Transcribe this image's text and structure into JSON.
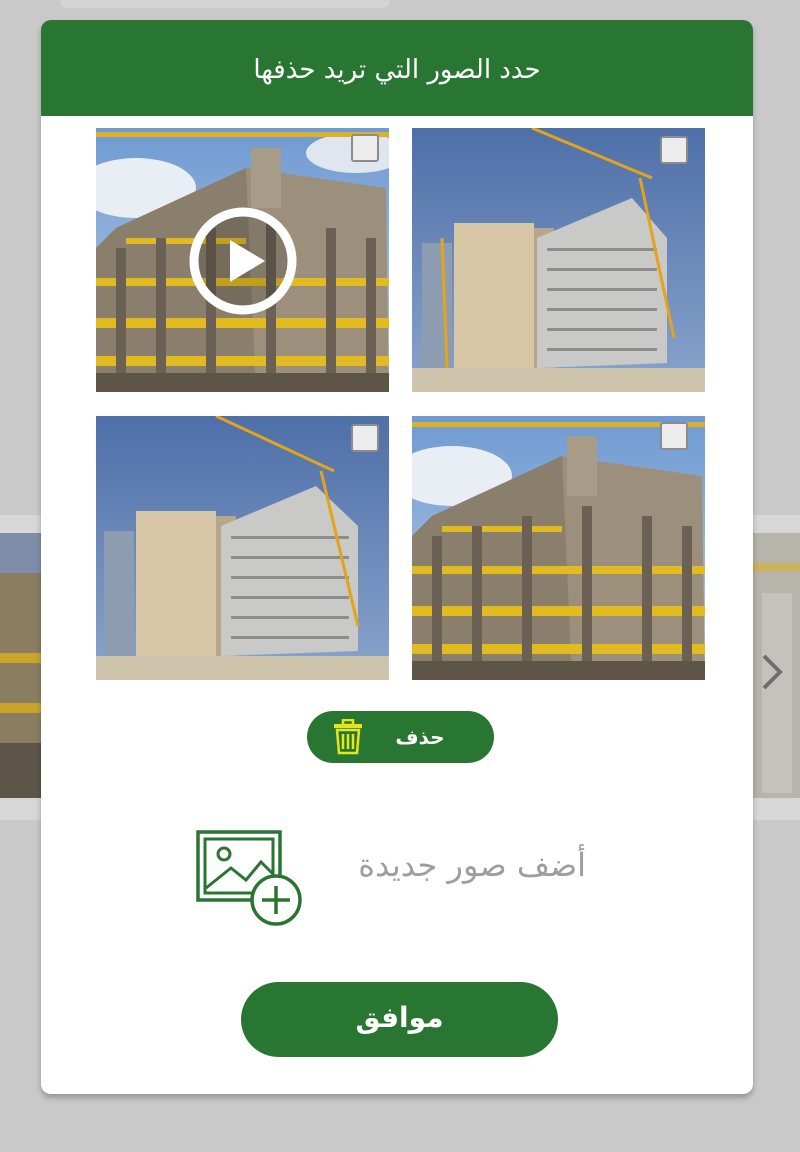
{
  "dialog": {
    "title": "حدد الصور التي تريد حذفها",
    "delete_label": "حذف",
    "add_photos_label": "أضف صور جديدة",
    "ok_label": "موافق"
  },
  "photos": [
    {
      "type": "video",
      "checked": false,
      "icon": "play-icon"
    },
    {
      "type": "image",
      "checked": false
    },
    {
      "type": "image",
      "checked": false
    },
    {
      "type": "image",
      "checked": false
    }
  ],
  "colors": {
    "accent_green": "#297633",
    "crane_yellow": "#e8c21a"
  }
}
